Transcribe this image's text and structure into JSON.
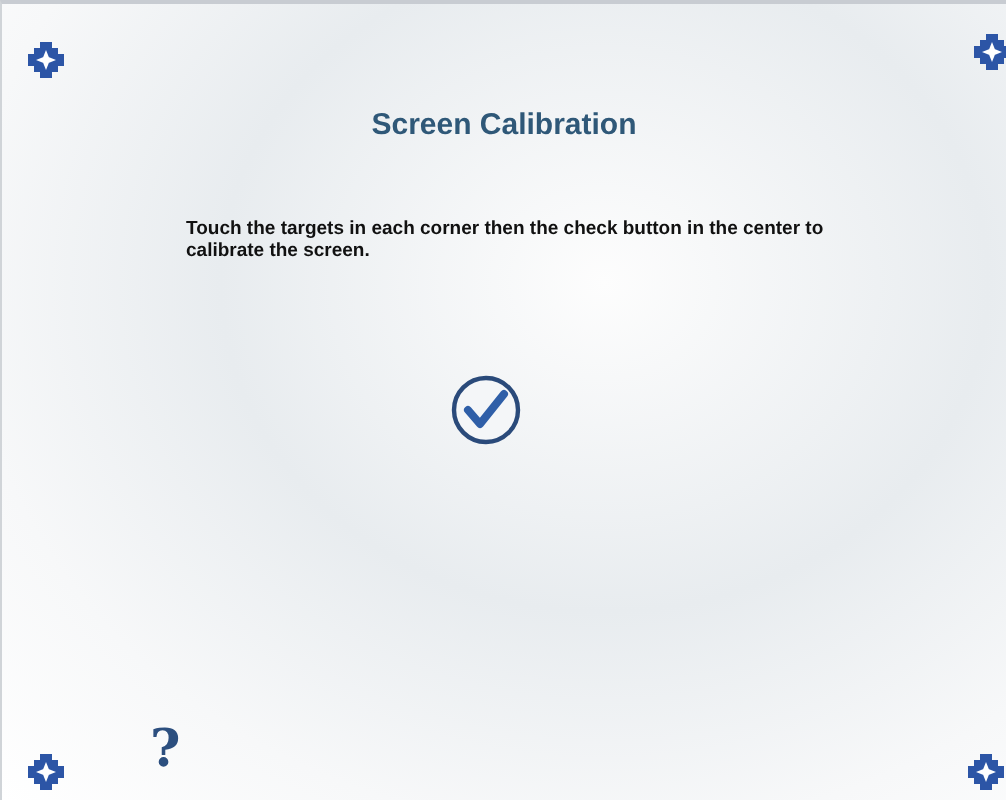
{
  "title": "Screen Calibration",
  "instructions": "Touch the targets in each corner then the check button in the center to calibrate the screen.",
  "help_label": "?"
}
